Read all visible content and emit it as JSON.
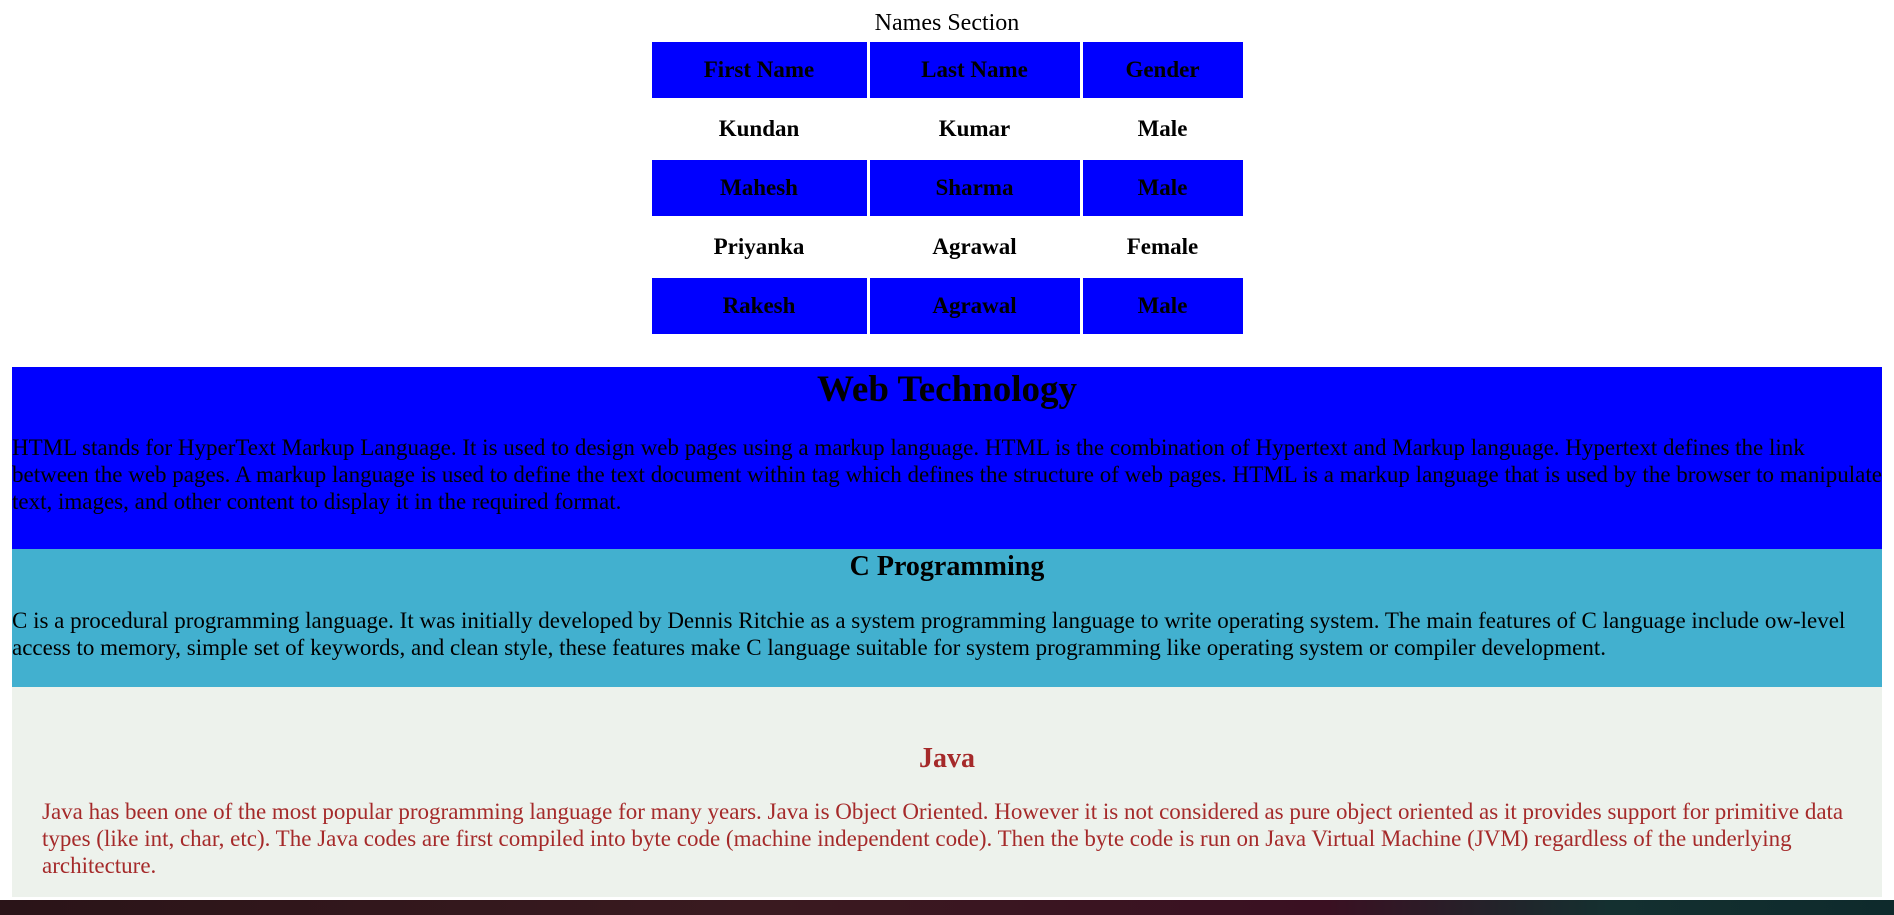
{
  "names_section": {
    "caption": "Names Section",
    "headers": [
      "First Name",
      "Last Name",
      "Gender"
    ],
    "rows": [
      [
        "Kundan",
        "Kumar",
        "Male"
      ],
      [
        "Mahesh",
        "Sharma",
        "Male"
      ],
      [
        "Priyanka",
        "Agrawal",
        "Female"
      ],
      [
        "Rakesh",
        "Agrawal",
        "Male"
      ]
    ]
  },
  "web_technology": {
    "title": "Web Technology",
    "body": "HTML stands for HyperText Markup Language. It is used to design web pages using a markup language. HTML is the combination of Hypertext and Markup language. Hypertext defines the link between the web pages. A markup language is used to define the text document within tag which defines the structure of web pages. HTML is a markup language that is used by the browser to manipulate text, images, and other content to display it in the required format."
  },
  "c_programming": {
    "title": "C Programming",
    "body": "C is a procedural programming language. It was initially developed by Dennis Ritchie as a system programming language to write operating system. The main features of C language include ow-level access to memory, simple set of keywords, and clean style, these features make C language suitable for system programming like operating system or compiler development."
  },
  "java": {
    "title": "Java",
    "body": "Java has been one of the most popular programming language for many years. Java is Object Oriented. However it is not considered as pure object oriented as it provides support for primitive data types (like int, char, etc). The Java codes are first compiled into byte code (machine independent code). Then the byte code is run on Java Virtual Machine (JVM) regardless of the underlying architecture."
  },
  "colors": {
    "blue_cell": "#0000ff",
    "c_section_bg": "#42b0cf",
    "java_section_bg": "#edf2ec",
    "java_text": "#a52a2a"
  }
}
